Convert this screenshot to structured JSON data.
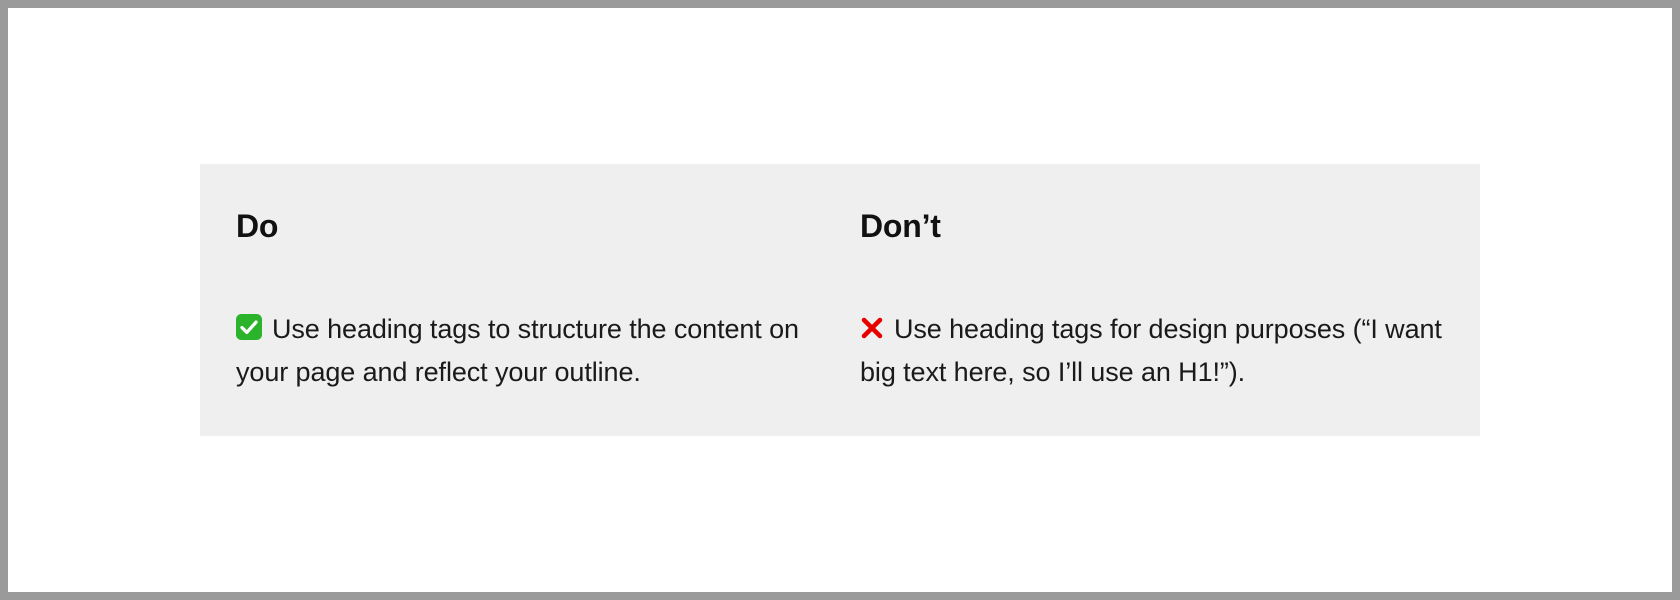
{
  "do": {
    "heading": "Do",
    "text": "Use heading tags to structure the content on your page and reflect your outline."
  },
  "dont": {
    "heading": "Don’t",
    "text": "Use heading tags for design purposes (“I want big text here, so I’ll use an H1!”)."
  }
}
